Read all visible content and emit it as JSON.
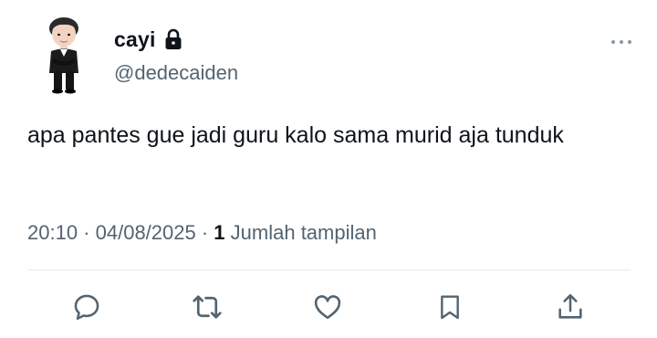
{
  "author": {
    "display_name": "cayi",
    "handle": "@dedecaiden",
    "avatar_icon": "profile-avatar-icon",
    "protected_icon": "lock-icon"
  },
  "tweet": {
    "text": "apa pantes gue jadi guru kalo sama murid aja tunduk"
  },
  "meta": {
    "time": "20:10",
    "separator1": " · ",
    "date": "04/08/2025",
    "separator2": " · ",
    "views_count": "1",
    "views_label": " Jumlah tampilan"
  },
  "actions": {
    "reply_icon": "reply-icon",
    "retweet_icon": "retweet-icon",
    "like_icon": "heart-icon",
    "bookmark_icon": "bookmark-icon",
    "share_icon": "share-icon"
  },
  "colors": {
    "text_primary": "#0f1419",
    "text_secondary": "#536471",
    "icon": "#536471",
    "divider": "#e6e9ec"
  }
}
